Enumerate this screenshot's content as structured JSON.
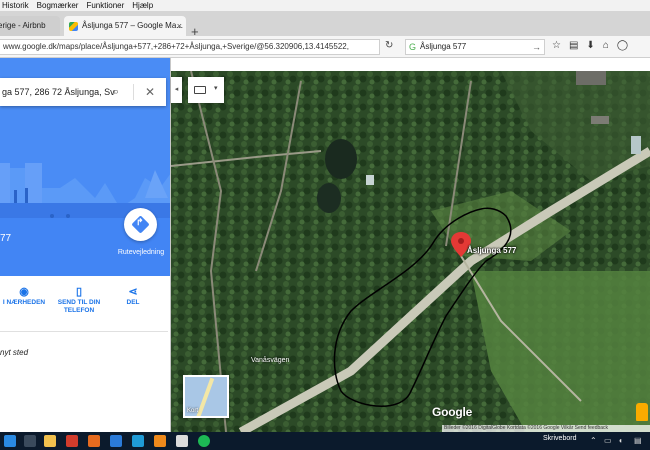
{
  "menubar": {
    "items": [
      "Historik",
      "Bogmærker",
      "Funktioner",
      "Hjælp"
    ]
  },
  "tabs": [
    {
      "label": "erige - Airbnb"
    },
    {
      "label": "Åsljunga 577 – Google Ma..."
    }
  ],
  "address_bar": {
    "url": "www.google.dk/maps/place/Åsljunga+577,+286+72+Åsljunga,+Sverige/@56.320906,13.4145522,",
    "search_value": "Åsljunga 577"
  },
  "panel": {
    "search_value": "ga 577, 286 72 Åsljunga, Sv",
    "address_fragment": "77",
    "directions_label": "Rutevejledning",
    "actions": [
      {
        "icon": "pin-icon",
        "label": "I NÆRHEDEN"
      },
      {
        "icon": "phone-icon",
        "label": "SEND TIL DIN TELEFON"
      },
      {
        "icon": "share-icon",
        "label": "DEL"
      }
    ],
    "add_place": "nyt sted"
  },
  "map": {
    "pin_label": "Åsljunga 577",
    "road_label": "Vanåsvägen",
    "minimap_label": "Kort",
    "logo": "Google",
    "attribution": "Billeder ©2016 DigitalGlobe Kortdata ©2016 Google   Vilkår   Send feedback"
  },
  "taskbar": {
    "desktop_label": "Skrivebord"
  },
  "colors": {
    "maps_blue": "#4285f4",
    "pin_red": "#e53935",
    "taskbar": "#0b1a2c"
  }
}
